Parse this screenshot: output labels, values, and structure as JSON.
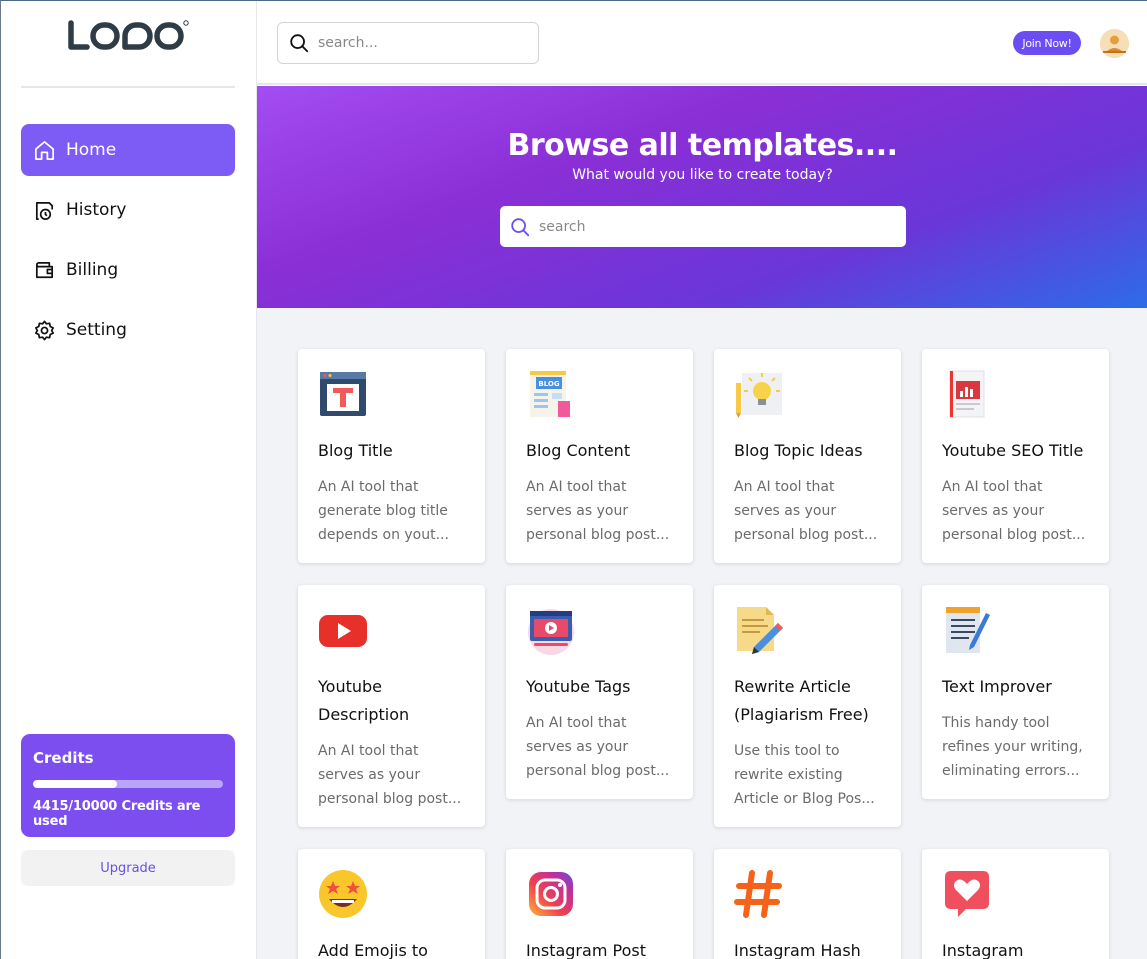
{
  "app": {
    "logo_text": "LOQO"
  },
  "sidebar": {
    "items": [
      {
        "label": "Home",
        "icon": "home-icon",
        "active": true
      },
      {
        "label": "History",
        "icon": "history-icon",
        "active": false
      },
      {
        "label": "Billing",
        "icon": "wallet-icon",
        "active": false
      },
      {
        "label": "Setting",
        "icon": "gear-icon",
        "active": false
      }
    ],
    "credits": {
      "title": "Credits",
      "used": 4415,
      "total": 10000,
      "text": "4415/10000 Credits are used"
    },
    "upgrade_label": "Upgrade"
  },
  "header": {
    "search_placeholder": "search...",
    "join_label": "Join Now!"
  },
  "hero": {
    "title": "Browse all templates....",
    "subtitle": "What would you like to create today?",
    "search_placeholder": "search"
  },
  "templates": [
    {
      "title": "Blog Title",
      "desc": "An AI tool that generate blog title depends on yout...",
      "icon": "blog-title-icon"
    },
    {
      "title": "Blog Content",
      "desc": "An AI tool that serves as your personal blog post...",
      "icon": "blog-content-icon"
    },
    {
      "title": "Blog Topic Ideas",
      "desc": "An AI tool that serves as your personal blog post...",
      "icon": "lightbulb-icon"
    },
    {
      "title": "Youtube SEO Title",
      "desc": "An AI tool that serves as your personal blog post...",
      "icon": "seo-report-icon"
    },
    {
      "title": "Youtube Description",
      "desc": "An AI tool that serves as your personal blog post...",
      "icon": "youtube-icon"
    },
    {
      "title": "Youtube Tags",
      "desc": "An AI tool that serves as your personal blog post...",
      "icon": "video-player-icon"
    },
    {
      "title": "Rewrite Article (Plagiarism Free)",
      "desc": "Use this tool to rewrite existing Article or Blog Pos...",
      "icon": "edit-document-icon"
    },
    {
      "title": "Text Improver",
      "desc": "This handy tool refines your writing, eliminating errors...",
      "icon": "notepad-icon"
    },
    {
      "title": "Add Emojis to",
      "desc": "",
      "icon": "star-eyes-emoji-icon"
    },
    {
      "title": "Instagram Post",
      "desc": "",
      "icon": "instagram-icon"
    },
    {
      "title": "Instagram Hash",
      "desc": "",
      "icon": "hashtag-icon"
    },
    {
      "title": "Instagram",
      "desc": "",
      "icon": "heart-chat-icon"
    }
  ]
}
